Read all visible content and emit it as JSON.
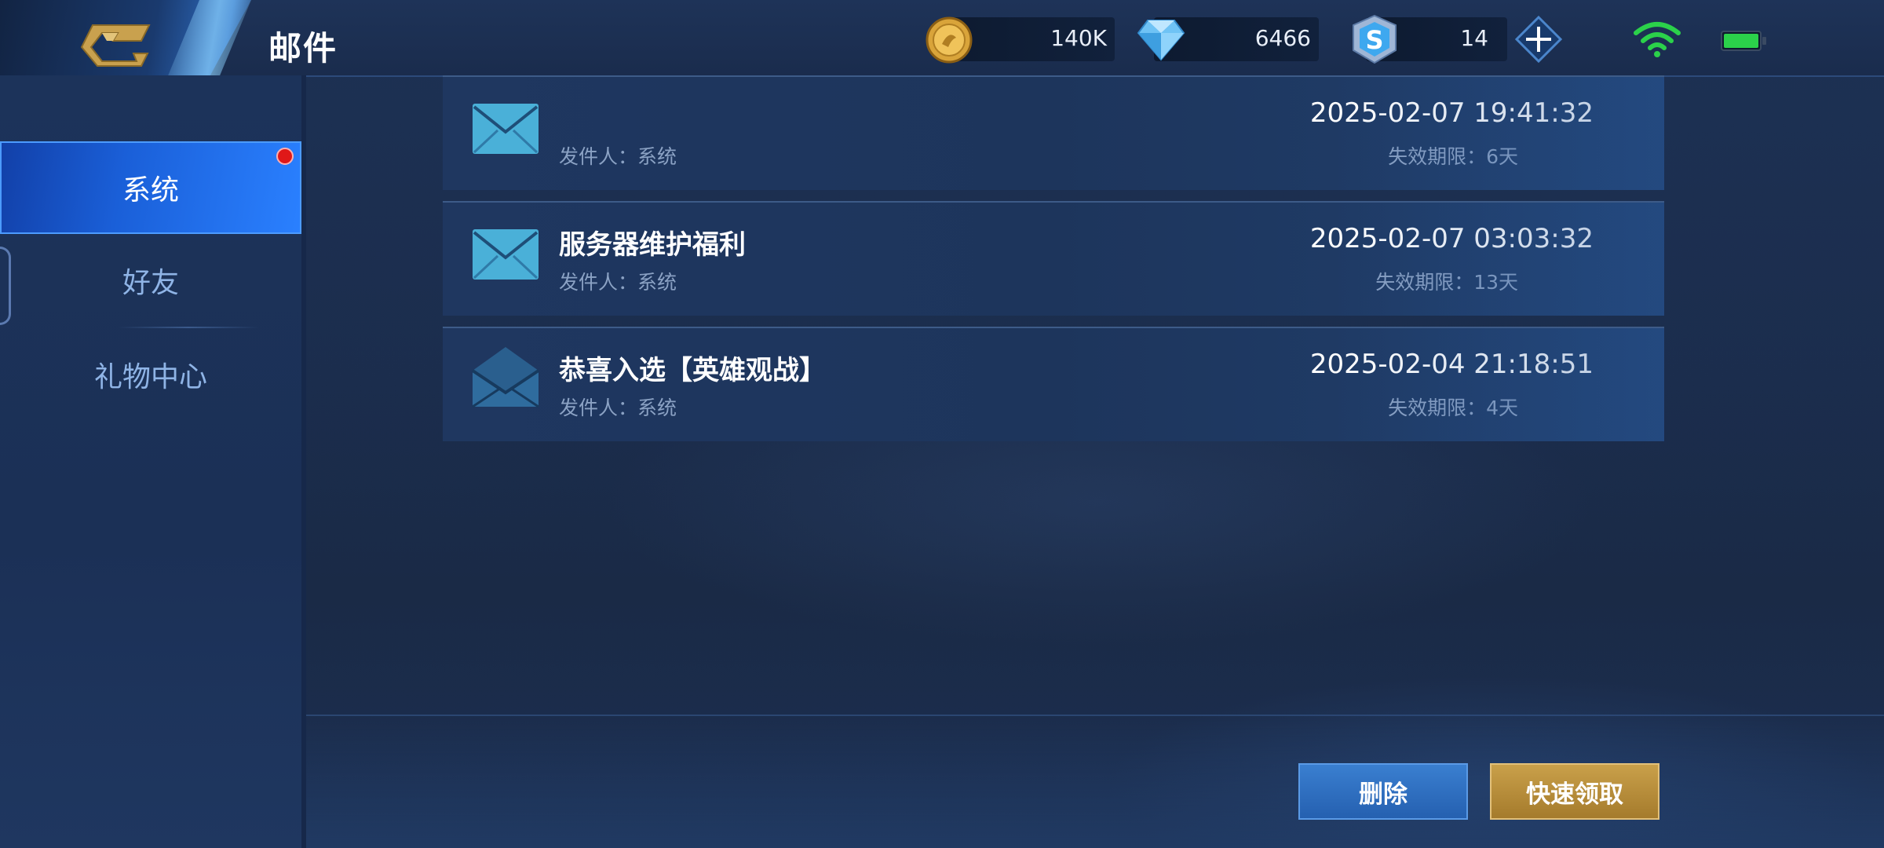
{
  "header": {
    "title": "邮件",
    "gold": "140K",
    "diamonds": "6466",
    "coupons": "14"
  },
  "sidebar": {
    "items": [
      {
        "label": "系统",
        "active": true,
        "has_notification": true
      },
      {
        "label": "好友",
        "active": false
      },
      {
        "label": "礼物中心",
        "active": false
      }
    ]
  },
  "mails": [
    {
      "subject": "",
      "sender": "发件人：系统",
      "time": "2025-02-07 19:41:32",
      "expire": "失效期限：6天",
      "opened": false
    },
    {
      "subject": "服务器维护福利",
      "sender": "发件人：系统",
      "time": "2025-02-07 03:03:32",
      "expire": "失效期限：13天",
      "opened": false
    },
    {
      "subject": "恭喜入选【英雄观战】",
      "sender": "发件人：系统",
      "time": "2025-02-04 21:18:51",
      "expire": "失效期限：4天",
      "opened": true
    }
  ],
  "actions": {
    "delete_label": "删除",
    "claim_label": "快速领取"
  },
  "colors": {
    "accent_blue": "#2a80ff",
    "gold_button": "#c9a04a",
    "notification_red": "#e01818",
    "wifi_green": "#2bd14a"
  },
  "icons": [
    "back-arrow-icon",
    "gold-coin-icon",
    "diamond-icon",
    "coupon-icon",
    "plus-icon",
    "wifi-icon",
    "battery-icon",
    "envelope-closed-icon",
    "envelope-open-icon"
  ]
}
